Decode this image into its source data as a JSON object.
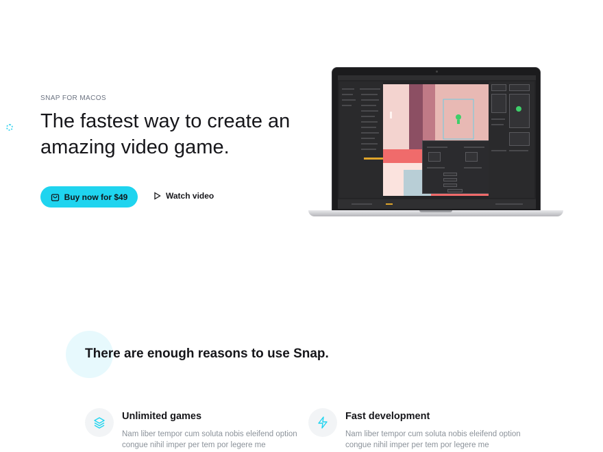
{
  "hero": {
    "eyebrow": "SNAP FOR MACOS",
    "title": "The fastest way to create an amazing video game.",
    "buy_label": "Buy now for $49",
    "watch_label": "Watch video"
  },
  "icons": {
    "buy": "shopping-bag-icon",
    "watch": "play-icon",
    "feature1": "layers-icon",
    "feature2": "lightning-icon"
  },
  "colors": {
    "accent": "#1fd4ef",
    "accent_light": "#e7f9fd",
    "muted_text": "#8b929a"
  },
  "reasons": {
    "title": "There are enough reasons to use Snap."
  },
  "features": [
    {
      "title": "Unlimited games",
      "text": "Nam liber tempor cum soluta nobis eleifend option congue nihil imper per tem por legere me"
    },
    {
      "title": "Fast development",
      "text": "Nam liber tempor cum soluta nobis eleifend option congue nihil imper per tem por legere me"
    }
  ]
}
